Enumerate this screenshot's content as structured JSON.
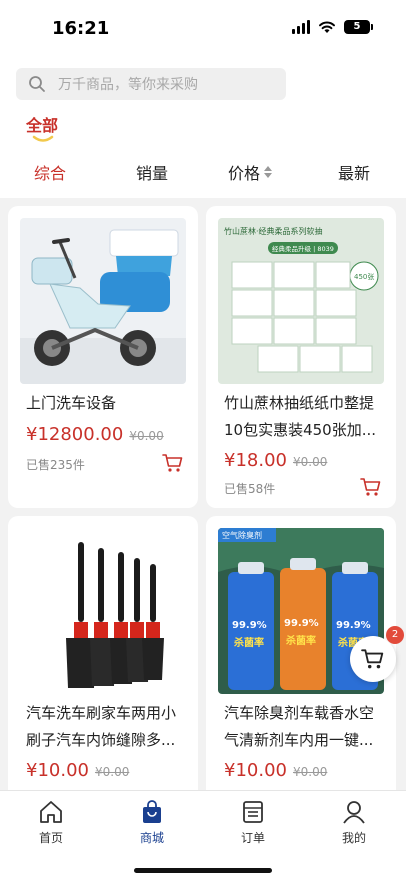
{
  "status_bar": {
    "time": "16:21",
    "battery": "5"
  },
  "search": {
    "placeholder": "万千商品，等你来采购"
  },
  "category": {
    "active": "全部"
  },
  "sort_tabs": [
    "综合",
    "销量",
    "价格",
    "最新"
  ],
  "products": [
    {
      "title": "上门洗车设备",
      "price": "¥12800.00",
      "original_price": "¥0.00",
      "sold": "已售235件"
    },
    {
      "title": "竹山蔗林抽纸纸巾整提10包实惠装450张加...",
      "price": "¥18.00",
      "original_price": "¥0.00",
      "sold": "已售58件"
    },
    {
      "title": "汽车洗车刷家车两用小刷子汽车内饰缝隙多...",
      "price": "¥10.00",
      "original_price": "¥0.00",
      "sold": ""
    },
    {
      "title": "汽车除臭剂车载香水空气清新剂车内用一键...",
      "price": "¥10.00",
      "original_price": "¥0.00",
      "sold": ""
    }
  ],
  "image_text": {
    "tissue_brand": "竹山蔗林·经典柔品系列软抽",
    "tissue_sub": "经典柔品升级 | 8039",
    "tissue_badge": "450张",
    "spray_tag": "空气除臭剂",
    "spray_big": "99.9%",
    "spray_small": "杀菌率"
  },
  "floating_cart": {
    "badge": "2"
  },
  "tabbar": [
    {
      "label": "首页",
      "icon": "home-icon"
    },
    {
      "label": "商城",
      "icon": "shopping-bag-icon"
    },
    {
      "label": "订单",
      "icon": "order-icon"
    },
    {
      "label": "我的",
      "icon": "user-icon"
    }
  ],
  "colors": {
    "accent_red": "#c8312a",
    "tab_active": "#1a3f8f"
  }
}
